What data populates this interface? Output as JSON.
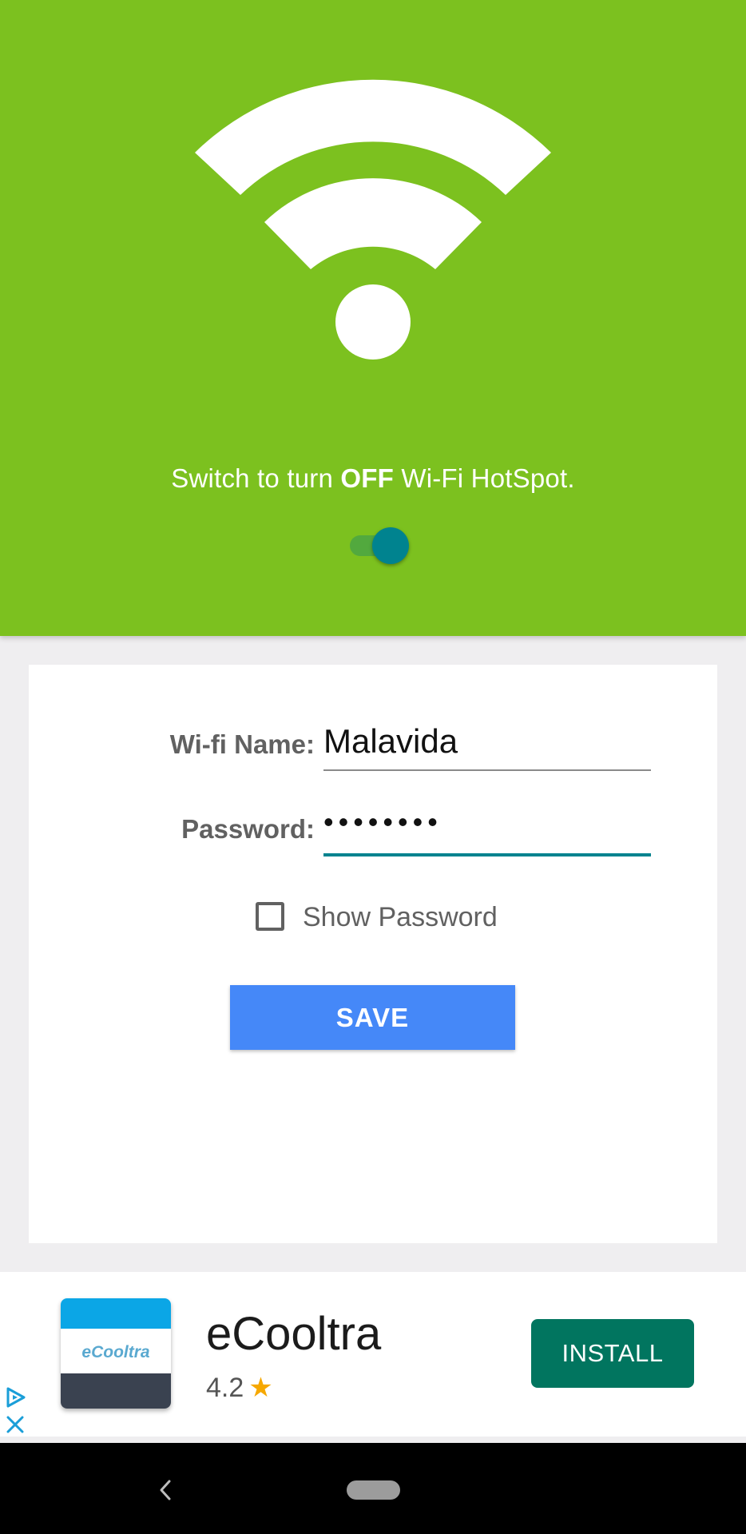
{
  "hero": {
    "text_before": "Switch to turn ",
    "text_bold": "OFF",
    "text_after": " Wi-Fi HotSpot.",
    "toggle_on": true,
    "icon": "wifi-icon",
    "color": "#7cc11f"
  },
  "form": {
    "wifi_name_label": "Wi-fi Name:",
    "wifi_name_value": "Malavida",
    "password_label": "Password:",
    "password_value": "••••••••",
    "show_password_label": "Show Password",
    "show_password_checked": false,
    "save_label": "SAVE",
    "accent_color": "#00838f",
    "button_color": "#4588f8"
  },
  "ad": {
    "app_name": "eCooltra",
    "icon_text": "eCooltra",
    "rating": "4.2",
    "star": "★",
    "install_label": "INSTALL",
    "install_color": "#01755f"
  },
  "navbar": {
    "back_icon": "back-icon",
    "home_icon": "home-pill-icon"
  }
}
